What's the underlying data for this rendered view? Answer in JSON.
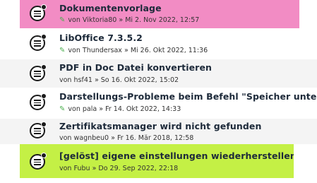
{
  "topics": [
    {
      "title": "Dokumentenvorlage",
      "attachment": true,
      "by": "von",
      "author": "Viktoria80",
      "sep": "»",
      "date": "Mi 2. Nov 2022, 12:57",
      "highlight": "pink"
    },
    {
      "title": "LibOffice 7.3.5.2",
      "attachment": true,
      "by": "von",
      "author": "Thundersax",
      "sep": "»",
      "date": "Mi 26. Okt 2022, 11:36",
      "highlight": "none"
    },
    {
      "title": "PDF in Doc Datei konvertieren",
      "attachment": false,
      "by": "von",
      "author": "hsf41",
      "sep": "»",
      "date": "So 16. Okt 2022, 15:02",
      "highlight": "none"
    },
    {
      "title": "Darstellungs-Probleme beim Befehl \"Speicher unter\"",
      "attachment": true,
      "by": "von",
      "author": "pala",
      "sep": "»",
      "date": "Fr 14. Okt 2022, 14:33",
      "highlight": "none"
    },
    {
      "title": "Zertifikatsmanager wird nicht gefunden",
      "attachment": false,
      "by": "von",
      "author": "wagnbeu0",
      "sep": "»",
      "date": "Fr 16. Mär 2018, 12:58",
      "highlight": "none"
    },
    {
      "title": "[gelöst] eigene einstellungen wiederherstellen ?",
      "attachment": false,
      "by": "von",
      "author": "Fubu",
      "sep": "»",
      "date": "Do 29. Sep 2022, 22:18",
      "highlight": "lime"
    }
  ],
  "icons": {
    "topic": "topic-unread-icon",
    "attachment": "paperclip-icon"
  },
  "colors": {
    "pink": "#f28cc4",
    "lime": "#c4f045",
    "attachment": "#4caf50",
    "title": "#1d2a3a"
  }
}
